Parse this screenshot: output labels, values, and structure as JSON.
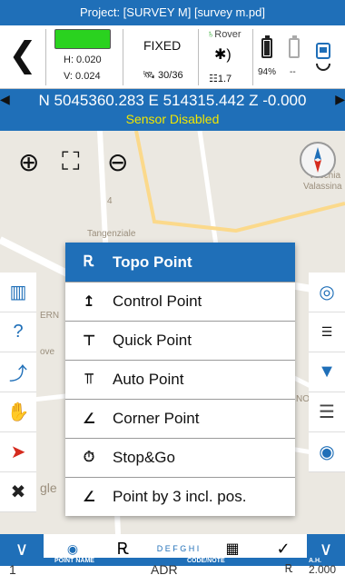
{
  "title": "Project: [SURVEY M] [survey m.pd]",
  "status": {
    "h": "H: 0.020",
    "v": "V: 0.024",
    "fix": "FIXED",
    "sats": "30/36",
    "rover": "Rover",
    "age": "1.7",
    "battery1_pct": "94%",
    "battery2_pct": "--",
    "fix_color": "#2ad21f"
  },
  "coordinates": {
    "text": "N 5045360.283 E 514315.442 Z -0.000",
    "sensor": "Sensor Disabled"
  },
  "map": {
    "labels": [
      "4",
      "Tangenziale",
      "Vecchia",
      "Valassina",
      "ERN",
      "ove",
      "NO",
      "gle"
    ]
  },
  "menu": {
    "items": [
      {
        "label": "Topo Point",
        "icon": "topo-point-icon"
      },
      {
        "label": "Control Point",
        "icon": "control-point-icon"
      },
      {
        "label": "Quick Point",
        "icon": "quick-point-icon"
      },
      {
        "label": "Auto Point",
        "icon": "auto-point-icon"
      },
      {
        "label": "Corner Point",
        "icon": "corner-point-icon"
      },
      {
        "label": "Stop&Go",
        "icon": "stop-go-icon"
      },
      {
        "label": "Point by 3 incl. pos.",
        "icon": "point-by-3-icon"
      }
    ]
  },
  "bottom": {
    "label_point": "POINT NAME",
    "label_code": "CODE/NOTE",
    "label_ah": "A.H.",
    "point_name": "1",
    "code": "ADR",
    "ah": "2.000",
    "keys": "D E F G H I"
  }
}
